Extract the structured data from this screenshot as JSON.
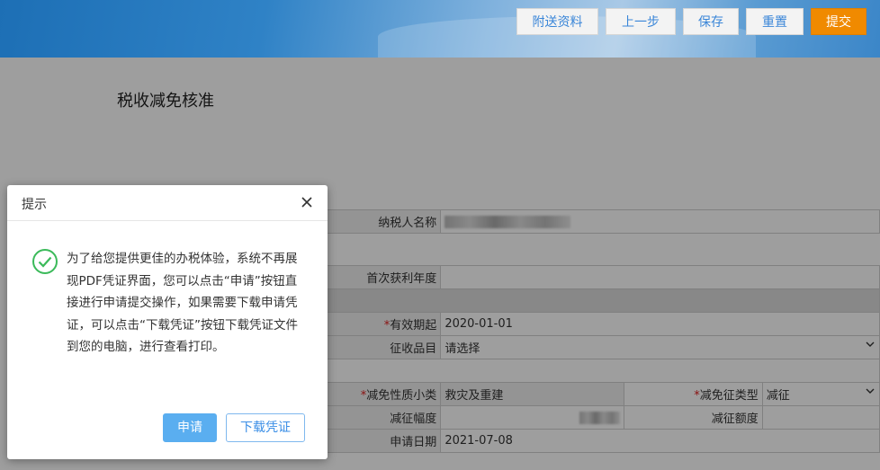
{
  "header": {
    "buttons": [
      {
        "label": "附送资料"
      },
      {
        "label": "上一步"
      },
      {
        "label": "保存"
      },
      {
        "label": "重置"
      },
      {
        "label": "提交"
      }
    ]
  },
  "page": {
    "title": "税收减免核准"
  },
  "form": {
    "taxpayer_name_label": "纳税人名称",
    "first_profit_year_label": "首次获利年度",
    "valid_start_required": "*",
    "valid_start_label": "有效期起",
    "valid_start_value": "2020-01-01",
    "levy_item_label": "征收品目",
    "levy_item_value": "请选择",
    "reduction_subcategory_required": "*",
    "reduction_subcategory_label": "减免性质小类",
    "reduction_subcategory_value": "救灾及重建",
    "reduction_type_required": "*",
    "reduction_type_label": "减免征类型",
    "reduction_type_value": "减征",
    "reduction_rate_label": "减征幅度",
    "reduction_amount_label": "减征额度",
    "apply_date_label": "申请日期",
    "apply_date_value": "2021-07-08"
  },
  "dialog": {
    "title": "提示",
    "message": "为了给您提供更佳的办税体验，系统不再展现PDF凭证界面，您可以点击“申请”按钮直接进行申请提交操作，如果需要下载申请凭证，可以点击“下载凭证”按钮下载凭证文件到您的电脑，进行查看打印。",
    "apply_label": "申请",
    "download_label": "下载凭证",
    "icon": "check-circle-icon",
    "close_icon": "close-icon"
  },
  "colors": {
    "primary_orange": "#f08a00",
    "apply_blue": "#5aaef0",
    "success_green": "#3bba5a"
  }
}
